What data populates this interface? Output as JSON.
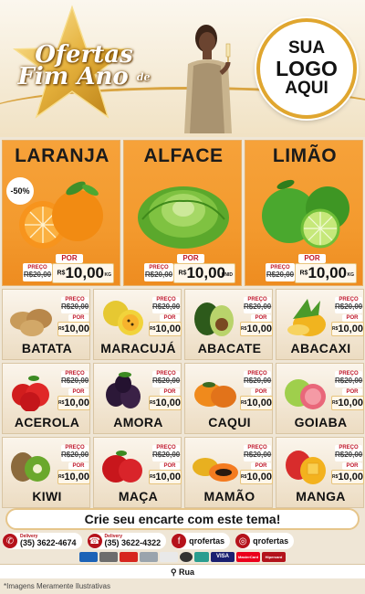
{
  "header": {
    "brand_line1": "Ofertas",
    "brand_de": "de",
    "brand_line2": "Fim Ano",
    "logo_line1": "SUA",
    "logo_line2": "LOGO",
    "logo_line3": "AQUI"
  },
  "featured": [
    {
      "name": "LARANJA",
      "discount": "-50%",
      "preco_label": "PREÇO",
      "old_price": "R$20,00",
      "por_label": "POR",
      "currency": "R$",
      "new_price": "10,00",
      "unit": "KG",
      "icon": "orange-icon"
    },
    {
      "name": "ALFACE",
      "preco_label": "PREÇO",
      "old_price": "R$20,00",
      "por_label": "POR",
      "currency": "R$",
      "new_price": "10,00",
      "unit": "UNID",
      "icon": "lettuce-icon"
    },
    {
      "name": "LIMÃO",
      "preco_label": "PREÇO",
      "old_price": "R$20,00",
      "por_label": "POR",
      "currency": "R$",
      "new_price": "10,00",
      "unit": "KG",
      "icon": "lime-icon"
    }
  ],
  "products": [
    {
      "name": "BATATA",
      "icon": "potato-icon"
    },
    {
      "name": "MARACUJÁ",
      "icon": "passion-fruit-icon"
    },
    {
      "name": "ABACATE",
      "icon": "avocado-icon"
    },
    {
      "name": "ABACAXI",
      "icon": "pineapple-icon"
    },
    {
      "name": "ACEROLA",
      "icon": "acerola-icon"
    },
    {
      "name": "AMORA",
      "icon": "blackberry-icon"
    },
    {
      "name": "CAQUI",
      "icon": "persimmon-icon"
    },
    {
      "name": "GOIABA",
      "icon": "guava-icon"
    },
    {
      "name": "KIWI",
      "icon": "kiwi-icon"
    },
    {
      "name": "MAÇA",
      "icon": "apple-icon"
    },
    {
      "name": "MAMÃO",
      "icon": "papaya-icon"
    },
    {
      "name": "MANGA",
      "icon": "mango-icon"
    }
  ],
  "small_price": {
    "preco_label": "PREÇO",
    "old_price": "R$20,00",
    "por_label": "POR",
    "currency": "R$",
    "new_price": "10,00"
  },
  "cta": "Crie seu encarte com este tema!",
  "contacts": {
    "whatsapp_label": "Delivery",
    "whatsapp": "(35) 3622-4674",
    "phone_label": "Delivery",
    "phone": "(35) 3622-4322",
    "facebook": "qrofertas",
    "instagram": "qrofertas"
  },
  "payments": [
    "VISA",
    "MasterCard",
    "Hipercard"
  ],
  "address": "Rua",
  "footer_note": "*Imagens Meramente Ilustrativas",
  "colors": {
    "accent": "#f39a2e",
    "brand_red": "#b5121b",
    "gold": "#e0a62f"
  }
}
